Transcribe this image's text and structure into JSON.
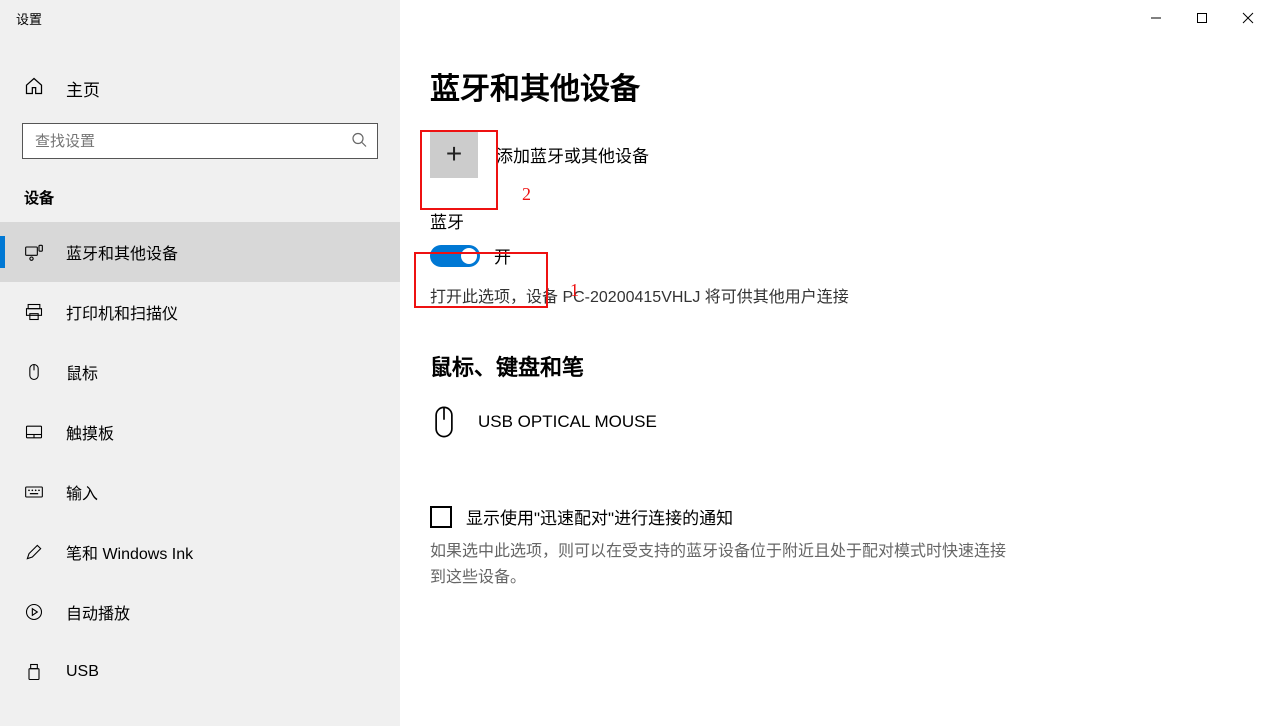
{
  "window": {
    "title": "设置"
  },
  "sidebar": {
    "home_label": "主页",
    "search_placeholder": "查找设置",
    "section_label": "设备",
    "items": [
      {
        "icon": "bluetooth-devices",
        "label": "蓝牙和其他设备",
        "active": true
      },
      {
        "icon": "printer",
        "label": "打印机和扫描仪",
        "active": false
      },
      {
        "icon": "mouse",
        "label": "鼠标",
        "active": false
      },
      {
        "icon": "touchpad",
        "label": "触摸板",
        "active": false
      },
      {
        "icon": "keyboard",
        "label": "输入",
        "active": false
      },
      {
        "icon": "pen",
        "label": "笔和 Windows Ink",
        "active": false
      },
      {
        "icon": "autoplay",
        "label": "自动播放",
        "active": false
      },
      {
        "icon": "usb",
        "label": "USB",
        "active": false
      }
    ]
  },
  "page": {
    "title": "蓝牙和其他设备",
    "add_device_label": "添加蓝牙或其他设备",
    "bluetooth_label": "蓝牙",
    "toggle_state_label": "开",
    "toggle_on": true,
    "bluetooth_hint": "打开此选项，设备 PC-20200415VHLJ 将可供其他用户连接",
    "devices_section_title": "鼠标、键盘和笔",
    "devices": [
      {
        "icon": "mouse",
        "name": "USB OPTICAL MOUSE"
      }
    ],
    "quick_pair_label": "显示使用\"迅速配对\"进行连接的通知",
    "quick_pair_checked": false,
    "quick_pair_hint": "如果选中此选项，则可以在受支持的蓝牙设备位于附近且处于配对模式时快速连接到这些设备。"
  },
  "annotations": {
    "label1": "1",
    "label2": "2"
  }
}
